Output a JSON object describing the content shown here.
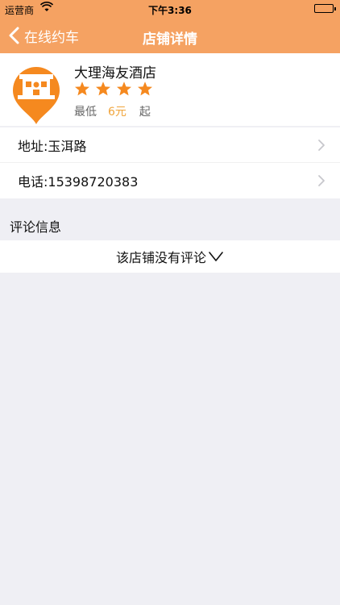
{
  "status": {
    "carrier": "运营商",
    "time": "下午3:36"
  },
  "nav": {
    "back_label": "在线约车",
    "title": "店铺详情"
  },
  "shop": {
    "name": "大理海友酒店",
    "rating": 4,
    "price_prefix": "最低",
    "price_value": "6元",
    "price_suffix": "起"
  },
  "address": "地址:玉洱路",
  "phone": "电话:15398720383",
  "comments": {
    "section_title": "评论信息",
    "empty_text": "该店铺没有评论"
  },
  "colors": {
    "header": "#f5a262",
    "accent": "#f5891f",
    "price": "#f0a43a",
    "background": "#efeff4"
  }
}
